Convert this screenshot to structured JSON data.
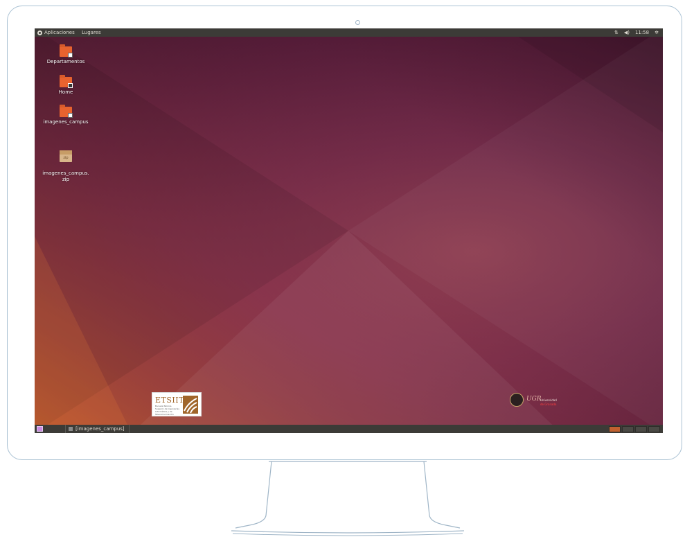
{
  "top_panel": {
    "applications_label": "Aplicaciones",
    "places_label": "Lugares",
    "network_icon": "network-arrows-icon",
    "volume_icon": "volume-icon",
    "clock": "11:58",
    "power_icon": "power-gear-icon"
  },
  "desktop_icons": [
    {
      "label": "Departamentos",
      "icon": "shared-folder-icon"
    },
    {
      "label": "Home",
      "icon": "home-folder-icon"
    },
    {
      "label": "imagenes_campus",
      "icon": "shared-folder-icon"
    },
    {
      "label": "imagenes_campus.\nzip",
      "icon": "zip-archive-icon",
      "badge": "zip"
    }
  ],
  "logos": {
    "etsiit_title": "ETSIIT",
    "etsiit_subtitle": "Escuela Técnica Superior de Ingenierías Informática y de Telecomunicación",
    "ugr_mark": "UGR",
    "ugr_line1": "Universidad",
    "ugr_line2": "de Granada"
  },
  "bottom_panel": {
    "task_label": "[imagenes_campus]"
  },
  "colors": {
    "panel": "#3c3b37",
    "wallpaper_dark": "#41162d",
    "wallpaper_light": "#9a4559",
    "folder_orange": "#e8632f",
    "active_workspace": "#c0612f"
  }
}
